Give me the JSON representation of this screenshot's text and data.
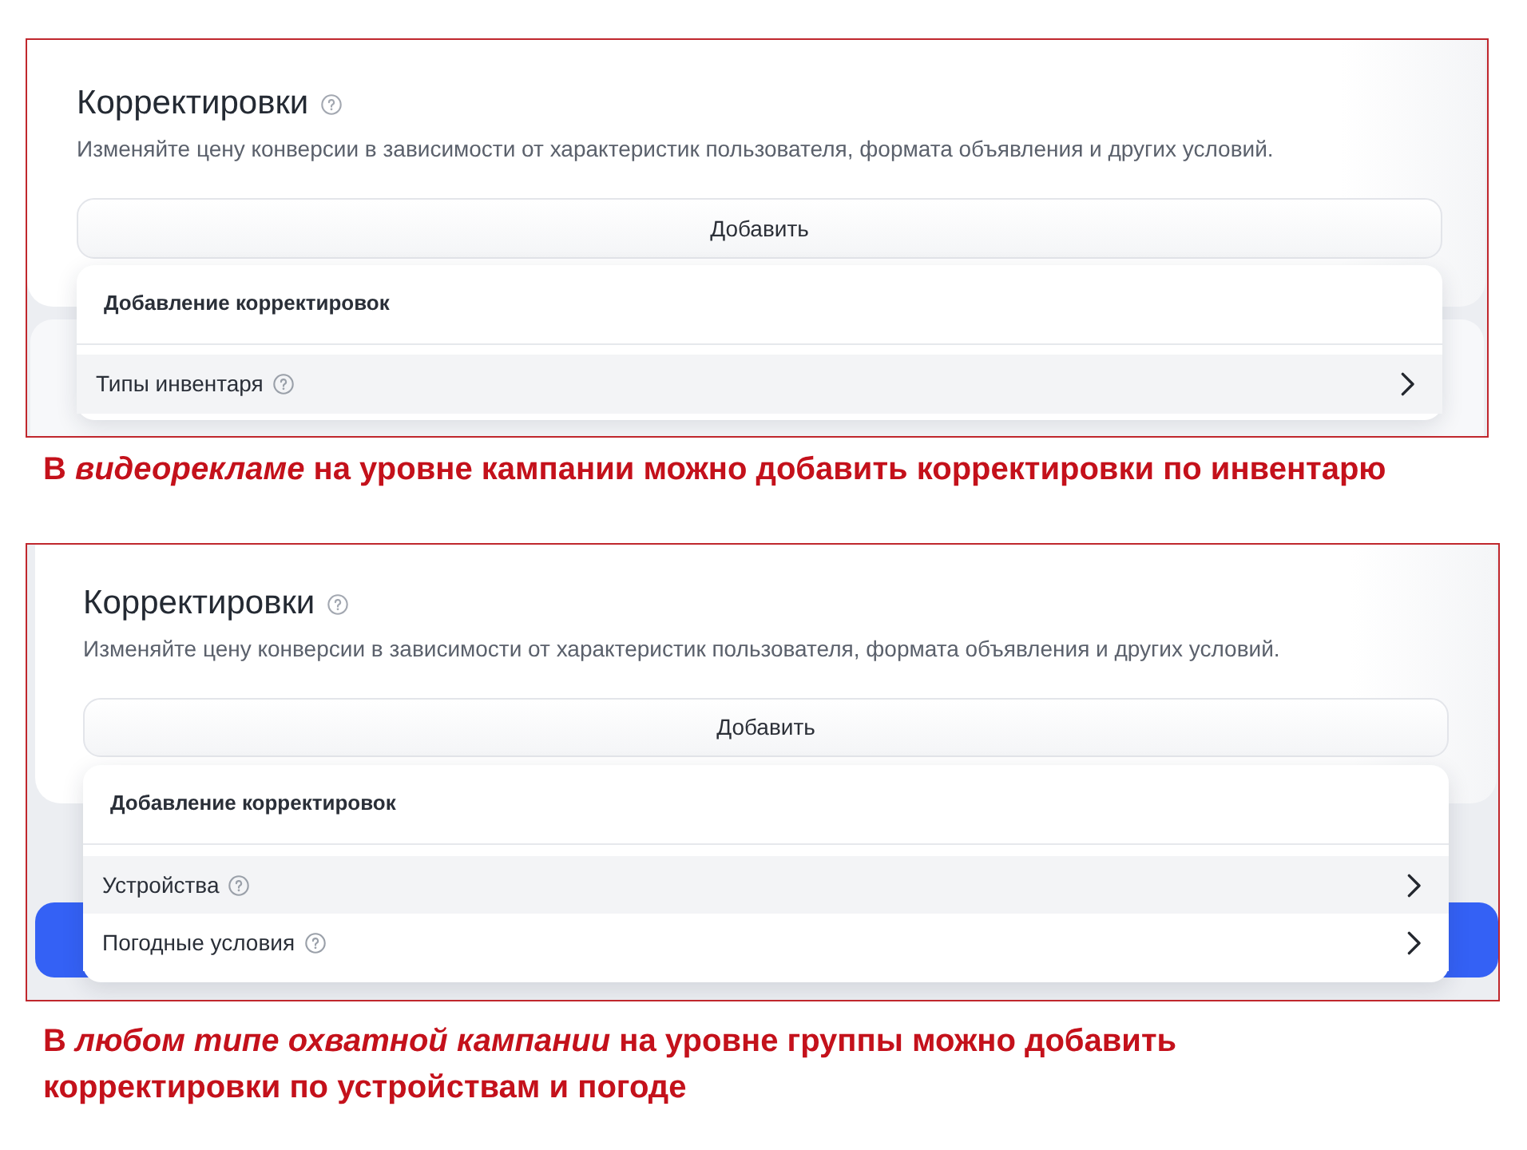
{
  "panels": [
    {
      "title": "Корректировки",
      "description": "Изменяйте цену конверсии в зависимости от характеристик пользователя, формата объявления и других условий.",
      "add_button": "Добавить",
      "menu": {
        "title": "Добавление корректировок",
        "items": [
          {
            "label": "Типы инвентаря",
            "selected": true
          }
        ]
      },
      "covered_element": {
        "kind": "card"
      },
      "caption": "В *видеорекламе* на уровне кампании можно добавить корректировки по инвентарю"
    },
    {
      "title": "Корректировки",
      "description": "Изменяйте цену конверсии в зависимости от характеристик пользователя, формата объявления и других условий.",
      "add_button": "Добавить",
      "menu": {
        "title": "Добавление корректировок",
        "items": [
          {
            "label": "Устройства",
            "selected": true
          },
          {
            "label": "Погодные условия",
            "selected": false
          }
        ]
      },
      "covered_element": {
        "kind": "button"
      },
      "caption": "В *любом типе охватной кампании* на уровне группы можно добавить корректировки по устройствам и погоде"
    }
  ]
}
